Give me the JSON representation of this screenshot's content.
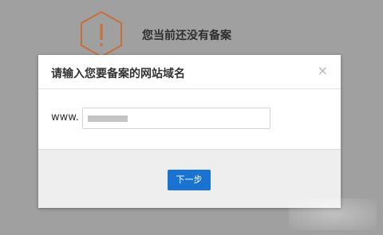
{
  "background_notice": {
    "icon": "warning-hexagon-icon",
    "text": "您当前还没有备案",
    "icon_color": "#e07a36"
  },
  "modal": {
    "title": "请输入您要备案的网站域名",
    "close_icon": "close-icon",
    "close_glyph": "×",
    "domain_prefix": "www.",
    "domain_input": {
      "value": ""
    },
    "next_button_label": "下一步",
    "accent_color": "#1a73d0"
  }
}
